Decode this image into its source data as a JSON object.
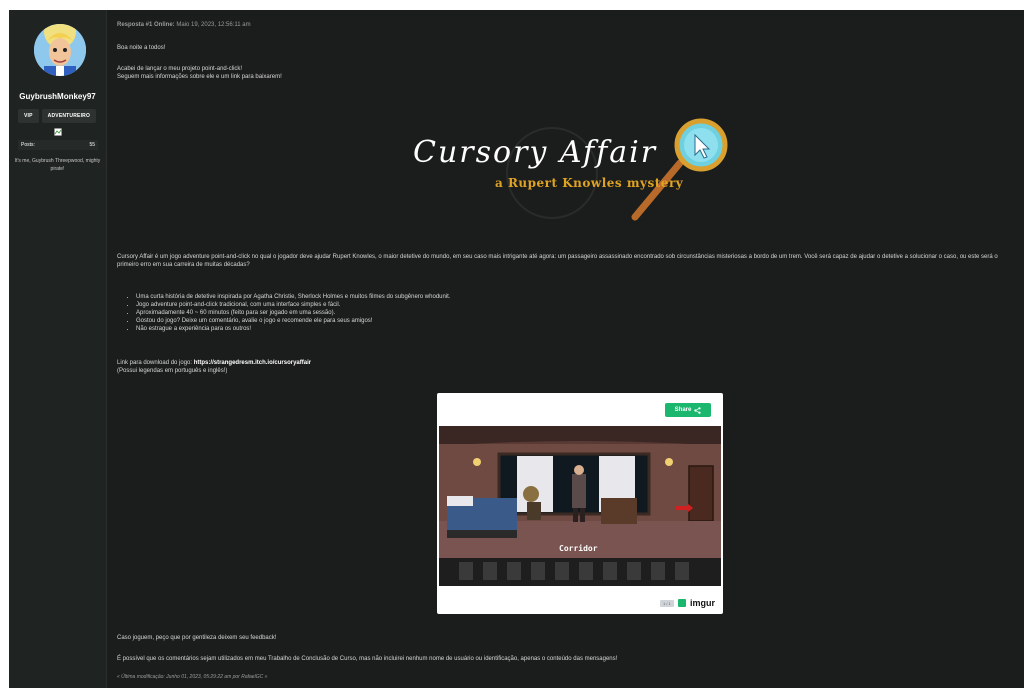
{
  "user": {
    "username": "GuybrushMonkey97",
    "badges": [
      "VIP",
      "ADVENTUREIRO"
    ],
    "posts_label": "Posts:",
    "posts_count": "55",
    "signature": "It's me, Guybrush Threepwood, mighty pirate!"
  },
  "post": {
    "meta_label": "Resposta #1 Online:",
    "meta_date": "Maio 19, 2023, 12:56:11 am",
    "greeting": "Boa noite a todos!",
    "intro_line1": "Acabei de lançar o meu projeto point-and-click!",
    "intro_line2": "Seguem mais informações sobre ele e um link para baixarem!",
    "banner_title": "Cursory Affair",
    "banner_subtitle": "a Rupert Knowles mystery",
    "description": "Cursory Affair é um jogo adventure point-and-click no qual o jogador deve ajudar Rupert Knowles, o maior detetive do mundo, em seu caso mais intrigante até agora: um passageiro assassinado encontrado sob circunstâncias misteriosas a bordo de um trem. Você será capaz de ajudar o detetive a solucionar o caso, ou este será o primeiro erro em sua carreira de muitas décadas?",
    "features": [
      "Uma curta história de detetive inspirada por Agatha Christie, Sherlock Holmes e muitos filmes do subgênero whodunit.",
      "Jogo adventure point-and-click tradicional, com uma interface simples e fácil.",
      "Aproximadamente 40 ~ 60 minutos (feito para ser jogado em uma sessão).",
      "Gostou do jogo? Deixe um comentário, avalie o jogo e recomende ele para seus amigos!",
      "Não estrague a experiência para os outros!"
    ],
    "download_label": "Link para download do jogo:",
    "download_url": "https://strangedresm.itch.io/cursoryaffair",
    "subtitles_note": "(Possui legendas em português e inglês!)",
    "feedback": "Caso joguem, peço que por gentileza deixem seu feedback!",
    "tcc_note": "É possível que os comentários sejam utilizados em meu Trabalho de Conclusão de Curso, mas não incluirei nenhum nome de usuário ou identificação, apenas o conteúdo das mensagens!",
    "edited": "« Última modificação: Junho 01, 2023, 05:29:22 am por RafaelGC »"
  },
  "imgur": {
    "share_label": "Share",
    "counter": "1 / 1",
    "logo_text": "imgur",
    "game_caption": "Corridor"
  },
  "colors": {
    "background": "#1b1d1c",
    "sidebar": "#1f2321",
    "share_green": "#1bb76e",
    "banner_gold": "#e0a323"
  }
}
